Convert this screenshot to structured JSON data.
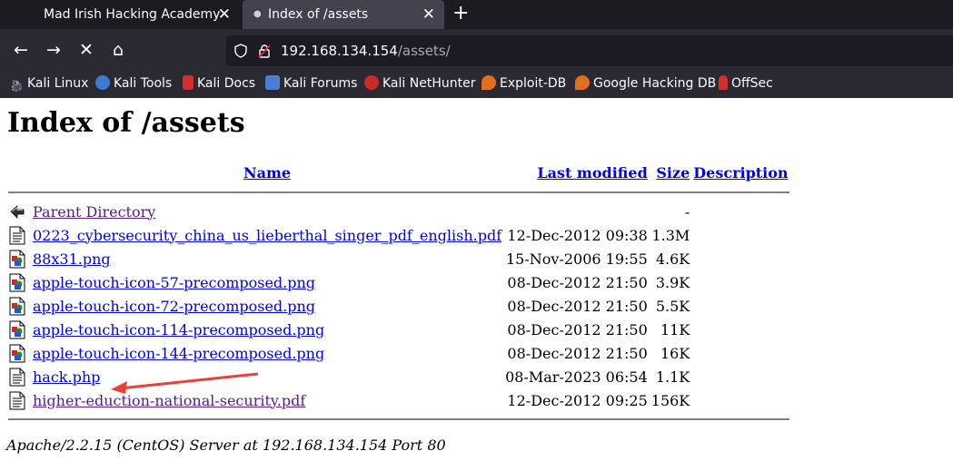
{
  "tabs": [
    {
      "title": "Mad Irish Hacking Academy",
      "close": "✕"
    },
    {
      "title": "Index of /assets",
      "close": "✕"
    }
  ],
  "new_tab": "+",
  "nav": {
    "back": "←",
    "forward": "→",
    "stop": "✕",
    "home": "⌂"
  },
  "url": {
    "host": "192.168.134.154",
    "path": "/assets/"
  },
  "bookmarks": [
    {
      "label": "Kali Linux",
      "icon": "kali-dragon-icon",
      "color": "#9aa7b4"
    },
    {
      "label": "Kali Tools",
      "icon": "kali-tools-icon",
      "color": "#3b7bd4"
    },
    {
      "label": "Kali Docs",
      "icon": "kali-docs-icon",
      "color": "#d32f2f"
    },
    {
      "label": "Kali Forums",
      "icon": "kali-forums-icon",
      "color": "#4a7fd0"
    },
    {
      "label": "Kali NetHunter",
      "icon": "nethunter-icon",
      "color": "#cc2a2a"
    },
    {
      "label": "Exploit-DB",
      "icon": "exploit-db-icon",
      "color": "#e07020"
    },
    {
      "label": "Google Hacking DB",
      "icon": "ghdb-icon",
      "color": "#e07020"
    },
    {
      "label": "OffSec",
      "icon": "offsec-icon",
      "color": "#d32f2f"
    }
  ],
  "page": {
    "title": "Index of /assets",
    "columns": {
      "name": "Name",
      "modified": "Last modified",
      "size": "Size",
      "description": "Description"
    },
    "rows": [
      {
        "name": "Parent Directory",
        "modified": "",
        "size": "-",
        "icon": "back-icon",
        "visited": true
      },
      {
        "name": "0223_cybersecurity_china_us_lieberthal_singer_pdf_english.pdf",
        "modified": "12-Dec-2012 09:38",
        "size": "1.3M",
        "icon": "text-file-icon",
        "visited": false
      },
      {
        "name": "88x31.png",
        "modified": "15-Nov-2006 19:55",
        "size": "4.6K",
        "icon": "image-file-icon",
        "visited": false
      },
      {
        "name": "apple-touch-icon-57-precomposed.png",
        "modified": "08-Dec-2012 21:50",
        "size": "3.9K",
        "icon": "image-file-icon",
        "visited": false
      },
      {
        "name": "apple-touch-icon-72-precomposed.png",
        "modified": "08-Dec-2012 21:50",
        "size": "5.5K",
        "icon": "image-file-icon",
        "visited": false
      },
      {
        "name": "apple-touch-icon-114-precomposed.png",
        "modified": "08-Dec-2012 21:50",
        "size": "11K",
        "icon": "image-file-icon",
        "visited": false
      },
      {
        "name": "apple-touch-icon-144-precomposed.png",
        "modified": "08-Dec-2012 21:50",
        "size": "16K",
        "icon": "image-file-icon",
        "visited": false
      },
      {
        "name": "hack.php",
        "modified": "08-Mar-2023 06:54",
        "size": "1.1K",
        "icon": "text-file-icon",
        "visited": false
      },
      {
        "name": "higher-eduction-national-security.pdf",
        "modified": "12-Dec-2012 09:25",
        "size": "156K",
        "icon": "text-file-icon",
        "visited": true
      }
    ],
    "footer": "Apache/2.2.15 (CentOS) Server at 192.168.134.154 Port 80",
    "annotation_color": "#e8413c"
  }
}
